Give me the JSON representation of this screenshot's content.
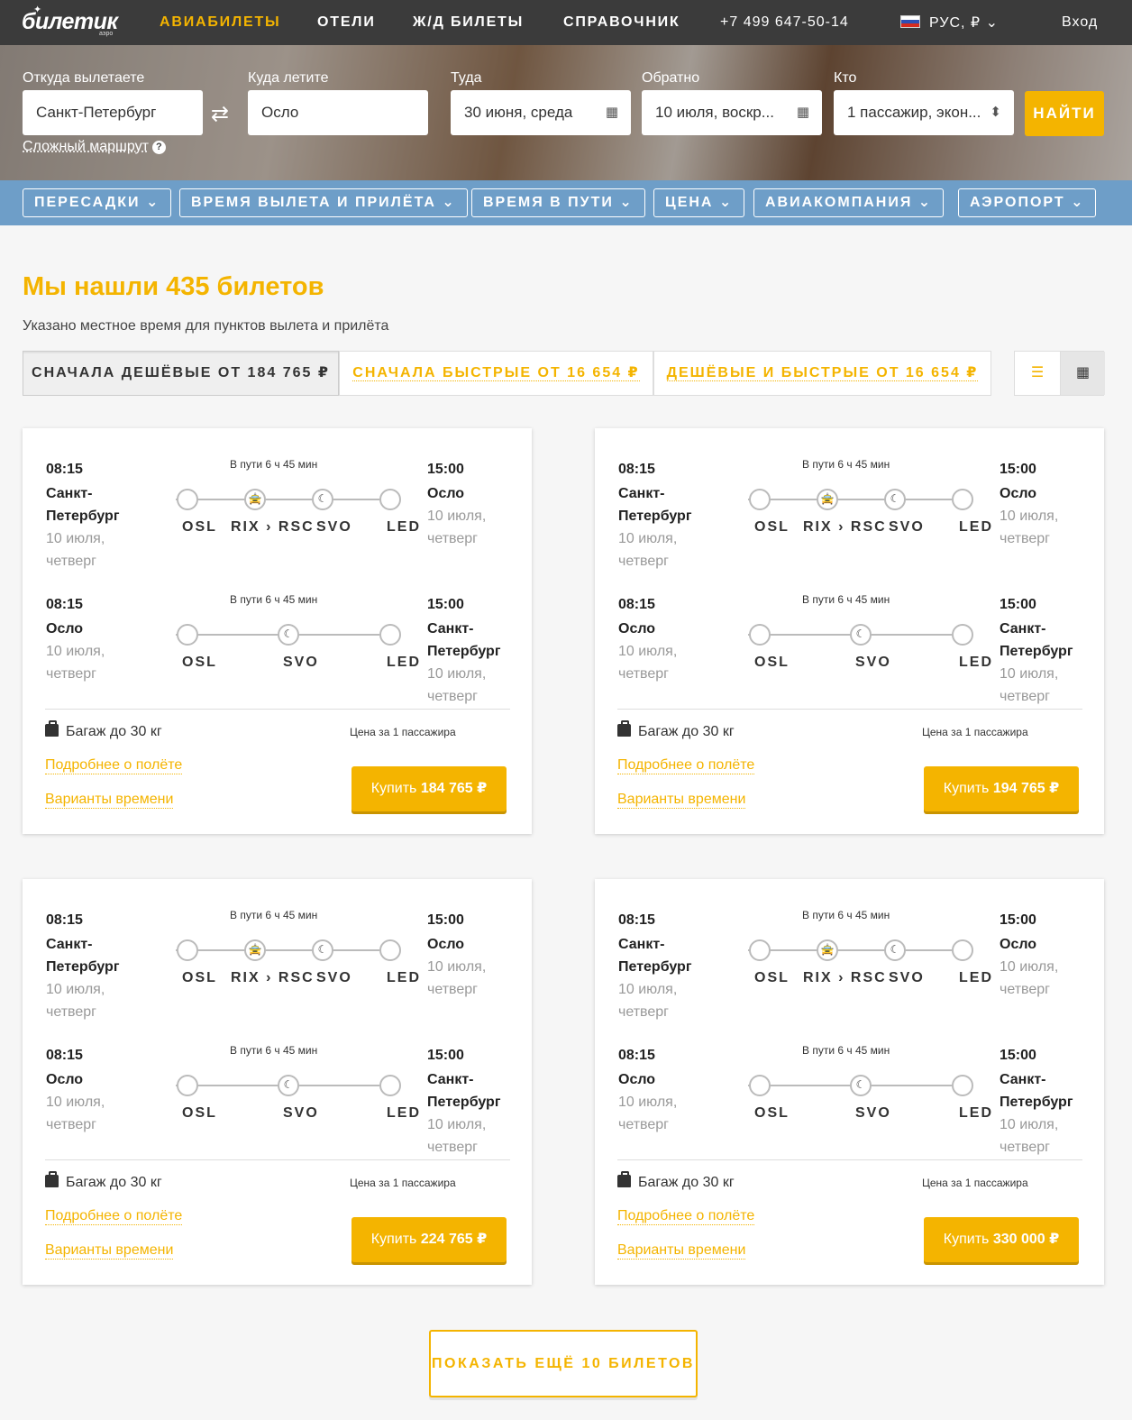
{
  "header": {
    "logo": "билетик",
    "logo_sub": "аэро",
    "nav": [
      "АВИАБИЛЕТЫ",
      "ОТЕЛИ",
      "Ж/Д БИЛЕТЫ",
      "СПРАВОЧНИК"
    ],
    "phone": "+7 499 647-50-14",
    "lang": "РУС, ₽",
    "login": "Вход"
  },
  "search": {
    "from_label": "Откуда вылетаете",
    "from_value": "Санкт-Петербург",
    "to_label": "Куда летите",
    "to_value": "Осло",
    "depart_label": "Туда",
    "depart_value": "30 июня, среда",
    "return_label": "Обратно",
    "return_value": "10 июля, воскр...",
    "who_label": "Кто",
    "who_value": "1 пассажир, экон...",
    "find": "НАЙТИ",
    "complex_route": "Сложный маршрут"
  },
  "filters": [
    "ПЕРЕСАДКИ",
    "ВРЕМЯ ВЫЛЕТА И ПРИЛЁТА",
    "ВРЕМЯ В ПУТИ",
    "ЦЕНА",
    "АВИАКОМПАНИЯ",
    "АЭРОПОРТ"
  ],
  "results": {
    "title": "Мы нашли 435 билетов",
    "note": "Указано местное время для пунктов вылета и прилёта",
    "sort": [
      "СНАЧАЛА ДЕШЁВЫЕ ОТ 184 765 ₽",
      "СНАЧАЛА БЫСТРЫЕ ОТ 16 654 ₽",
      "ДЕШЁВЫЕ И БЫСТРЫЕ ОТ 16 654 ₽"
    ]
  },
  "card_common": {
    "dep_time": "08:15",
    "arr_time": "15:00",
    "duration": "В пути 6 ч 45 мин",
    "out_dep_city": "Санкт-Петербург",
    "out_arr_city": "Осло",
    "ret_dep_city": "Осло",
    "ret_arr_city": "Санкт-Петербург",
    "date": "10 июля, четверг",
    "out_codes": [
      "OSL",
      "RIX › RSC",
      "SVO",
      "LED"
    ],
    "ret_codes": [
      "OSL",
      "SVO",
      "LED"
    ],
    "baggage": "Багаж до 30 кг",
    "price_note": "Цена за 1 пассажира",
    "details": "Подробнее о полёте",
    "times": "Варианты времени",
    "buy_prefix": "Купить"
  },
  "cards": [
    {
      "price": "184 765 ₽"
    },
    {
      "price": "194 765 ₽"
    },
    {
      "price": "224 765 ₽"
    },
    {
      "price": "330 000 ₽"
    }
  ],
  "more": "ПОКАЗАТЬ ЕЩЁ 10 БИЛЕТОВ",
  "colors": {
    "accent": "#f4b400",
    "filterbar": "#6e9ec8",
    "topbar": "#3b3b3b"
  }
}
